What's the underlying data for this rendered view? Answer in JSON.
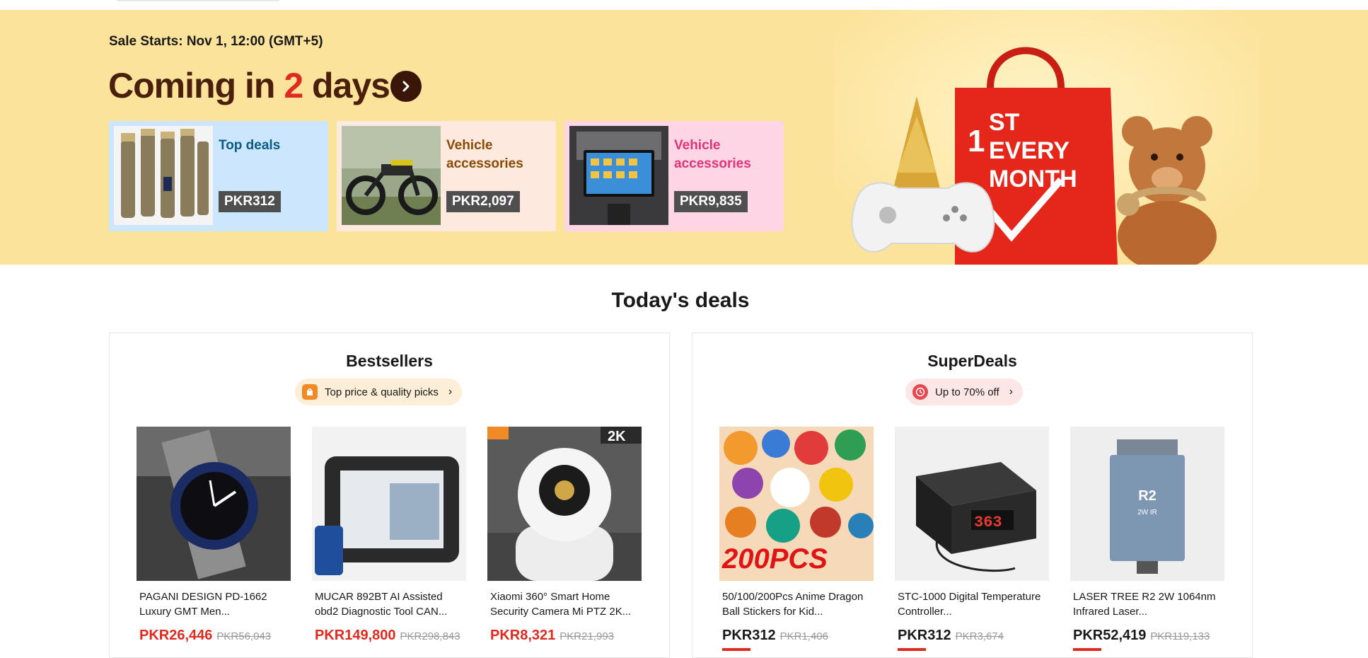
{
  "banner": {
    "sale_starts": "Sale Starts: Nov 1, 12:00 (GMT+5)",
    "coming_prefix": "Coming in ",
    "coming_number": "2",
    "coming_suffix": " days",
    "hero_text": "1ST EVERY MONTH",
    "categories": [
      {
        "title": "Top deals",
        "price": "PKR312"
      },
      {
        "title": "Vehicle accessories",
        "price": "PKR2,097"
      },
      {
        "title": "Vehicle accessories",
        "price": "PKR9,835"
      }
    ]
  },
  "deals": {
    "title": "Today's deals",
    "bestsellers": {
      "title": "Bestsellers",
      "pill": "Top price & quality picks",
      "products": [
        {
          "name": "PAGANI DESIGN PD-1662 Luxury GMT Men...",
          "price": "PKR26,446",
          "old_price": "PKR56,043"
        },
        {
          "name": "MUCAR 892BT AI Assisted obd2 Diagnostic Tool CAN...",
          "price": "PKR149,800",
          "old_price": "PKR298,843"
        },
        {
          "name": "Xiaomi 360° Smart Home Security Camera Mi PTZ 2K...",
          "price": "PKR8,321",
          "old_price": "PKR21,993"
        }
      ]
    },
    "superdeals": {
      "title": "SuperDeals",
      "pill": "Up to 70% off",
      "products": [
        {
          "name": "50/100/200Pcs Anime Dragon Ball Stickers for Kid...",
          "price": "PKR312",
          "old_price": "PKR1,406"
        },
        {
          "name": "STC-1000 Digital Temperature Controller...",
          "price": "PKR312",
          "old_price": "PKR3,674"
        },
        {
          "name": "LASER TREE R2 2W 1064nm Infrared Laser...",
          "price": "PKR52,419",
          "old_price": "PKR119,133"
        }
      ]
    },
    "image_text": {
      "stickers": "200PCS",
      "camera_badge": "2K",
      "thermo_display": "363",
      "laser_label": "R2",
      "laser_sub": "2W IR"
    }
  },
  "colors": {
    "banner_bg": "#fce39b",
    "accent_red": "#e02a1f",
    "coming_brown": "#4a1f0c"
  }
}
